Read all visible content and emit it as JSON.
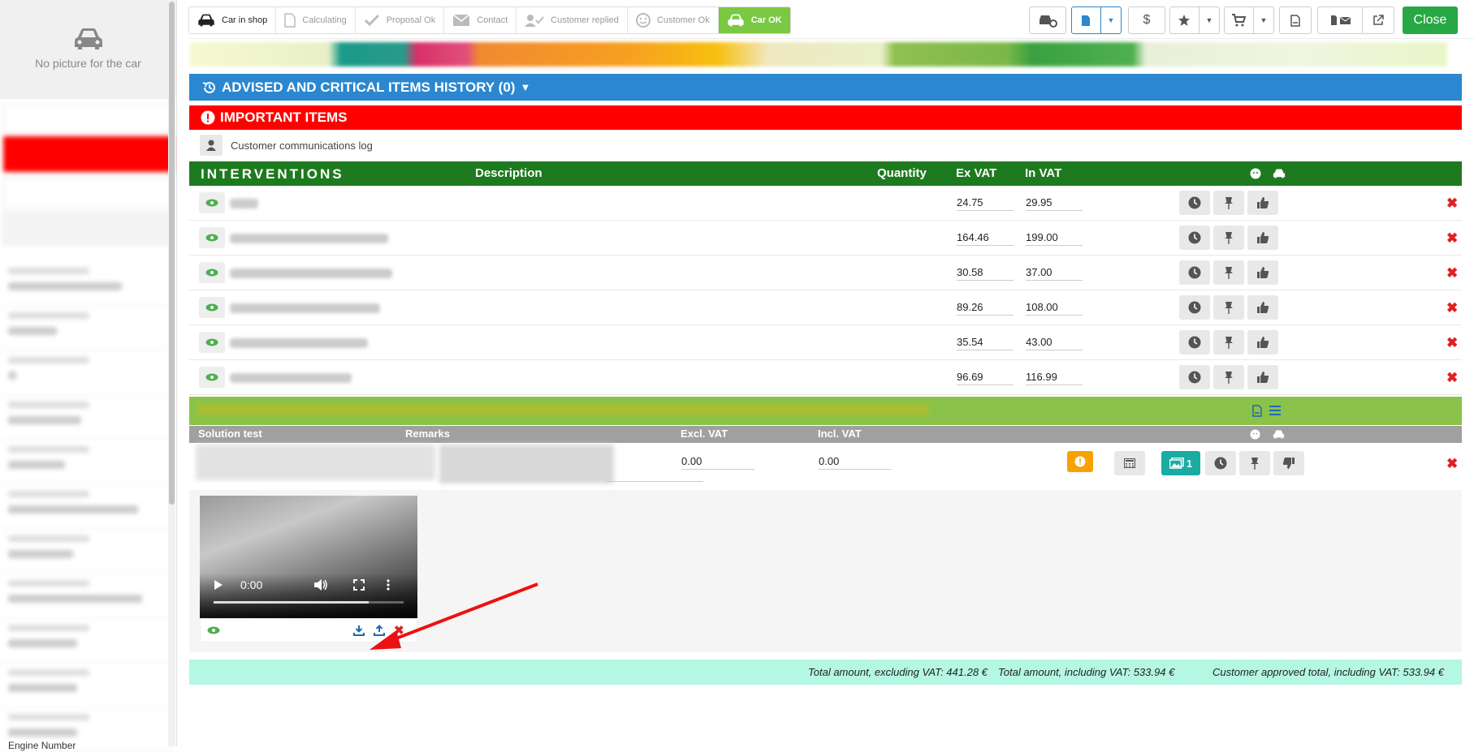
{
  "left_panel": {
    "no_picture": "No picture for the car",
    "engine_number": "Engine Number"
  },
  "steps": [
    {
      "label": "Car in shop",
      "icon": "car-icon"
    },
    {
      "label": "Calculating",
      "icon": "document-icon"
    },
    {
      "label": "Proposal Ok",
      "icon": "check-icon"
    },
    {
      "label": "Contact",
      "icon": "envelope-icon"
    },
    {
      "label": "Customer replied",
      "icon": "user-check-icon"
    },
    {
      "label": "Customer Ok",
      "icon": "smile-icon"
    },
    {
      "label": "Car OK",
      "icon": "car-icon"
    }
  ],
  "toolbar": {
    "dollar": "$",
    "close_label": "Close"
  },
  "sections": {
    "advised": "ADVISED AND CRITICAL ITEMS HISTORY (0)",
    "important": "IMPORTANT ITEMS",
    "comm_log": "Customer communications log"
  },
  "interventions": {
    "title": "INTERVENTIONS",
    "columns": {
      "description": "Description",
      "quantity": "Quantity",
      "ex_vat": "Ex VAT",
      "in_vat": "In VAT"
    },
    "rows": [
      {
        "ex": "24.75",
        "in": "29.95"
      },
      {
        "ex": "164.46",
        "in": "199.00"
      },
      {
        "ex": "30.58",
        "in": "37.00"
      },
      {
        "ex": "89.26",
        "in": "108.00"
      },
      {
        "ex": "35.54",
        "in": "43.00"
      },
      {
        "ex": "96.69",
        "in": "116.99"
      }
    ]
  },
  "solution": {
    "columns": {
      "test": "Solution test",
      "remarks": "Remarks",
      "excl": "Excl. VAT",
      "incl": "Incl. VAT"
    },
    "excl_value": "0.00",
    "incl_value": "0.00",
    "photo_count": "1"
  },
  "video": {
    "time": "0:00"
  },
  "totals": {
    "excl": "Total amount, excluding VAT: 441.28 €",
    "incl": "Total amount, including VAT: 533.94 €",
    "approved": "Customer approved total, including VAT: 533.94 €"
  },
  "colors": {
    "advised_bg": "#2a87d0",
    "important_bg": "#ff0000",
    "interventions_bg": "#1e7a1e",
    "solution_bg": "#8bc34a",
    "totals_bg": "#b4f7e3",
    "close_bg": "#28a745",
    "active_step_bg": "#7bc843"
  }
}
